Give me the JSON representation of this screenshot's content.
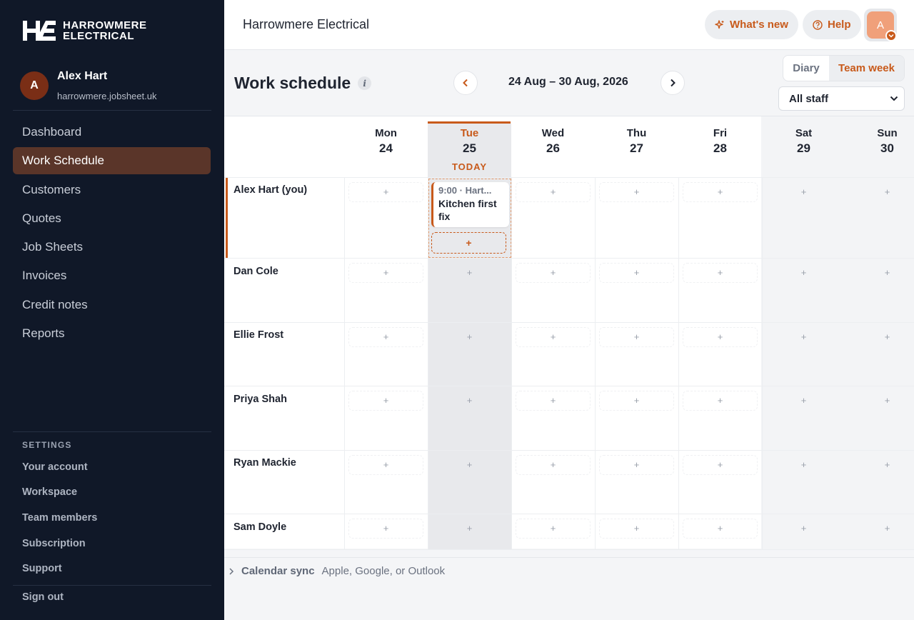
{
  "brand": {
    "line1": "HARROWMERE",
    "line2": "ELECTRICAL"
  },
  "user": {
    "initial": "A",
    "name": "Alex Hart",
    "domain": "harrowmere.jobsheet.uk"
  },
  "nav": [
    {
      "label": "Dashboard",
      "active": false
    },
    {
      "label": "Work Schedule",
      "active": true
    },
    {
      "label": "Customers",
      "active": false
    },
    {
      "label": "Quotes",
      "active": false
    },
    {
      "label": "Job Sheets",
      "active": false
    },
    {
      "label": "Invoices",
      "active": false
    },
    {
      "label": "Credit notes",
      "active": false
    },
    {
      "label": "Reports",
      "active": false
    }
  ],
  "settings": {
    "heading": "SETTINGS",
    "items": [
      "Your account",
      "Workspace",
      "Team members",
      "Subscription",
      "Support"
    ],
    "sign_out": "Sign out"
  },
  "topbar": {
    "title": "Harrowmere Electrical",
    "whats_new": "What's new",
    "help": "Help",
    "avatar_initial": "A"
  },
  "schedule": {
    "title": "Work schedule",
    "info": "i",
    "prev": "‹",
    "next": "›",
    "date_range": "24 Aug – 30 Aug, 2026",
    "view_diary": "Diary",
    "view_team": "Team week",
    "staff_filter": "All staff",
    "today_label": "TODAY",
    "days": [
      {
        "name": "Mon",
        "date": "24"
      },
      {
        "name": "Tue",
        "date": "25",
        "today": true
      },
      {
        "name": "Wed",
        "date": "26"
      },
      {
        "name": "Thu",
        "date": "27"
      },
      {
        "name": "Fri",
        "date": "28"
      },
      {
        "name": "Sat",
        "date": "29",
        "weekend": true
      },
      {
        "name": "Sun",
        "date": "30",
        "weekend": true
      }
    ],
    "staff": [
      "Alex Hart (you)",
      "Dan Cole",
      "Ellie Frost",
      "Priya Shah",
      "Ryan Mackie",
      "Sam Doyle"
    ],
    "cell_add": "+",
    "job": {
      "meta": "9:00 · Hart...",
      "title": "Kitchen first fix"
    },
    "add_job": "+"
  },
  "footer": {
    "sync_label": "Calendar sync",
    "sync_sub": "Apple, Google, or Outlook"
  },
  "colors": {
    "accent": "#c85a1b",
    "sidebar": "#101828",
    "active_nav": "#5a3529"
  }
}
